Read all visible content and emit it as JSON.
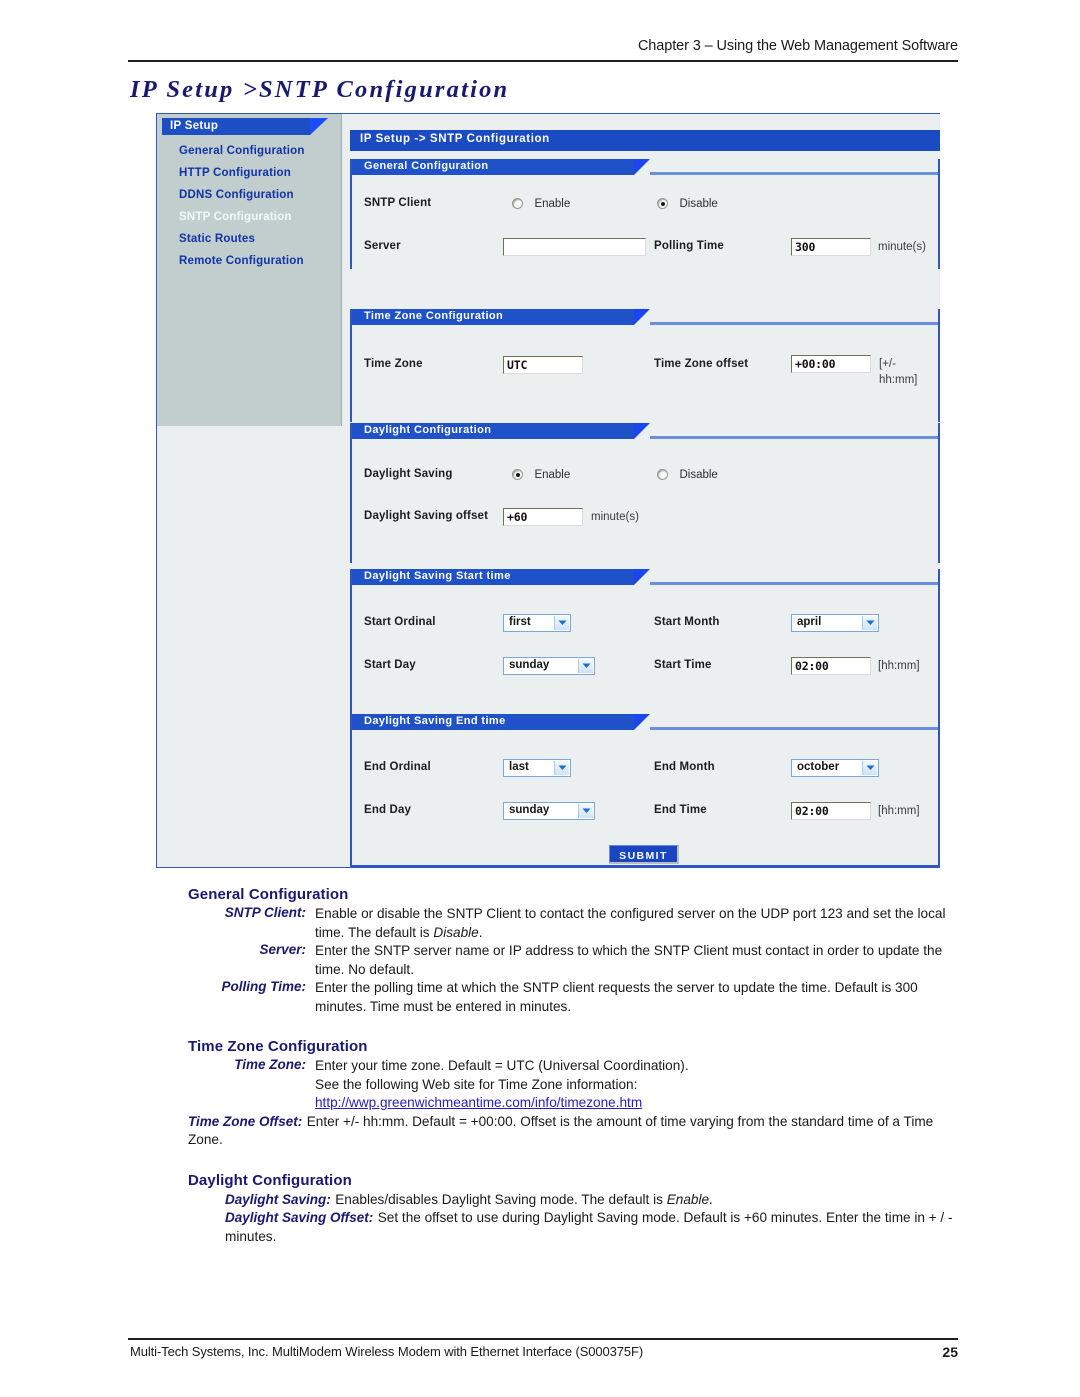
{
  "page": {
    "running_head": "Chapter 3 – Using the Web Management Software",
    "title": "IP Setup >SNTP Configuration",
    "footer_text": "Multi-Tech Systems, Inc. MultiModem Wireless Modem with Ethernet Interface (S000375F)",
    "page_number": "25"
  },
  "colors": {
    "title_blue": "#191970",
    "header_bar_blue": "#1f51c9",
    "wedge_blue": "#1b45f0",
    "sidebar_bg": "#c2cdcd",
    "panel_bg": "#eceff0",
    "link_blue": "#2222bb",
    "submit_blue": "#1a45c0"
  },
  "ui": {
    "sidebar": {
      "tab_label": "IP Setup",
      "items": [
        {
          "label": "General Configuration",
          "active": false
        },
        {
          "label": "HTTP Configuration",
          "active": false
        },
        {
          "label": "DDNS Configuration",
          "active": false
        },
        {
          "label": "SNTP Configuration",
          "active": true
        },
        {
          "label": "Static Routes",
          "active": false
        },
        {
          "label": "Remote Configuration",
          "active": false
        }
      ]
    },
    "breadcrumb": "IP Setup  ->  SNTP Configuration",
    "sections": {
      "general": {
        "title": "General Configuration",
        "sntp_client_label": "SNTP Client",
        "enable_label": "Enable",
        "disable_label": "Disable",
        "sntp_client_value": "Disable",
        "server_label": "Server",
        "server_value": "",
        "polling_time_label": "Polling Time",
        "polling_time_value": "300",
        "polling_time_units": "minute(s)"
      },
      "timezone": {
        "title": "Time Zone Configuration",
        "time_zone_label": "Time Zone",
        "time_zone_value": "UTC",
        "offset_label": "Time Zone offset",
        "offset_value": "+00:00",
        "offset_hint_1": "[+/-",
        "offset_hint_2": "hh:mm]"
      },
      "daylight": {
        "title": "Daylight Configuration",
        "saving_label": "Daylight Saving",
        "enable_label": "Enable",
        "disable_label": "Disable",
        "saving_value": "Enable",
        "offset_label": "Daylight Saving offset",
        "offset_value": "+60",
        "offset_units": "minute(s)"
      },
      "dst_start": {
        "title": "Daylight Saving Start time",
        "ordinal_label": "Start Ordinal",
        "ordinal_value": "first",
        "month_label": "Start Month",
        "month_value": "april",
        "day_label": "Start Day",
        "day_value": "sunday",
        "time_label": "Start Time",
        "time_value": "02:00",
        "time_hint": "[hh:mm]"
      },
      "dst_end": {
        "title": "Daylight Saving End time",
        "ordinal_label": "End Ordinal",
        "ordinal_value": "last",
        "month_label": "End Month",
        "month_value": "october",
        "day_label": "End Day",
        "day_value": "sunday",
        "time_label": "End Time",
        "time_value": "02:00",
        "time_hint": "[hh:mm]"
      },
      "submit_label": "SUBMIT"
    }
  },
  "docs": {
    "general": {
      "heading": "General Configuration",
      "entries": [
        {
          "term": "SNTP Client:",
          "desc": "Enable or disable the SNTP Client to contact the configured server on the UDP port 123 and set the local time. The default is Disable."
        },
        {
          "term": "Server:",
          "desc": "Enter the SNTP server name or IP address to which the SNTP Client must contact in order to update the time. No default."
        },
        {
          "term": "Polling Time:",
          "desc": "Enter the polling time at which the SNTP client requests the server to update the time. Default is 300 minutes. Time must be entered in minutes."
        }
      ]
    },
    "timezone": {
      "heading": "Time Zone Configuration",
      "time_zone_term": "Time Zone:",
      "time_zone_line1": "Enter your time zone. Default = UTC (Universal Coordination).",
      "time_zone_line2": "See the following Web site for Time Zone information:",
      "time_zone_url": "http://wwp.greenwichmeantime.com/info/timezone.htm",
      "offset_term": "Time Zone Offset:",
      "offset_desc": "Enter +/- hh:mm. Default = +00:00. Offset is the amount of time varying from the standard time of a Time Zone."
    },
    "daylight": {
      "heading": "Daylight Configuration",
      "saving_term": "Daylight Saving:",
      "saving_desc": "Enables/disables Daylight Saving mode. The default is Enable.",
      "offset_term": "Daylight Saving Offset:",
      "offset_desc": "Set the offset to use during Daylight Saving mode. Default is +60 minutes. Enter the time in + / - minutes."
    }
  }
}
